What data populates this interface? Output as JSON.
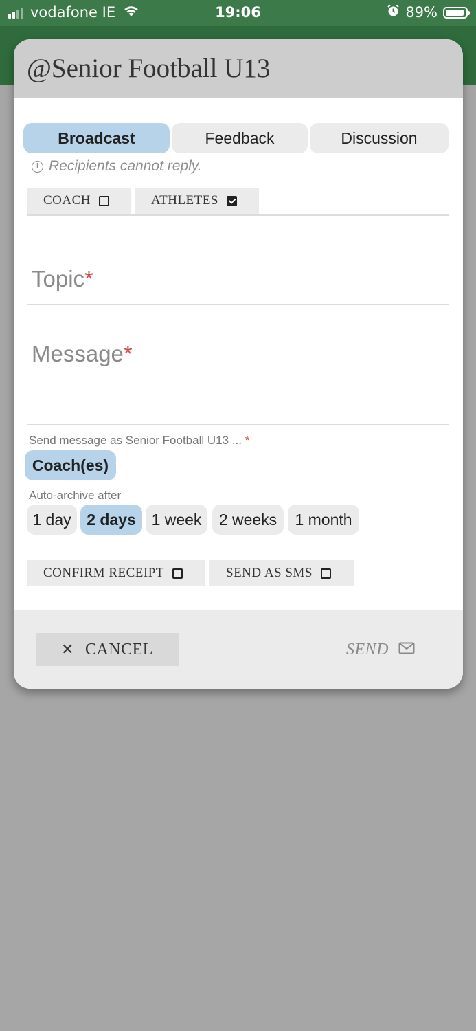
{
  "status_bar": {
    "carrier": "vodafone IE",
    "time": "19:06",
    "battery": "89%",
    "battery_level": 0.89,
    "icons": [
      "signal-icon",
      "wifi-icon",
      "alarm-icon",
      "battery-icon"
    ]
  },
  "modal": {
    "title": "@Senior Football U13",
    "tabs": [
      {
        "label": "Broadcast",
        "active": true
      },
      {
        "label": "Feedback",
        "active": false
      },
      {
        "label": "Discussion",
        "active": false
      }
    ],
    "hint": "Recipients cannot reply.",
    "recipients": [
      {
        "label": "COACH",
        "checked": false
      },
      {
        "label": "ATHLETES",
        "checked": true
      }
    ],
    "topic": {
      "label": "Topic",
      "required_mark": "*",
      "value": ""
    },
    "message": {
      "label": "Message",
      "required_mark": "*",
      "value": ""
    },
    "send_as": {
      "label": "Send message as Senior Football U13 ...",
      "required_mark": "*",
      "selected": "Coach(es)"
    },
    "auto_archive": {
      "label": "Auto-archive after",
      "options": [
        "1 day",
        "2 days",
        "1 week",
        "2 weeks",
        "1 month"
      ],
      "selected": "2 days"
    },
    "options": [
      {
        "label": "CONFIRM RECEIPT",
        "checked": false
      },
      {
        "label": "SEND AS SMS",
        "checked": false
      }
    ],
    "footer": {
      "cancel_label": "CANCEL",
      "send_label": "SEND"
    }
  },
  "colors": {
    "active_tab": "#b7d3ea",
    "header_bg": "#cdcdcd",
    "app_green": "#2f6b3d",
    "required": "#d24a4a",
    "overlay": "#a6a6a6"
  }
}
